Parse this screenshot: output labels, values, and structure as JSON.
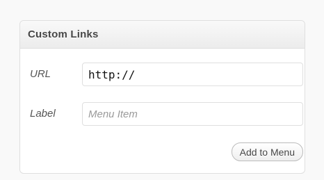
{
  "panel": {
    "title": "Custom Links",
    "url_field": {
      "label": "URL",
      "value": "http://",
      "placeholder": ""
    },
    "label_field": {
      "label": "Label",
      "value": "",
      "placeholder": "Menu Item"
    },
    "add_button_label": "Add to Menu"
  }
}
